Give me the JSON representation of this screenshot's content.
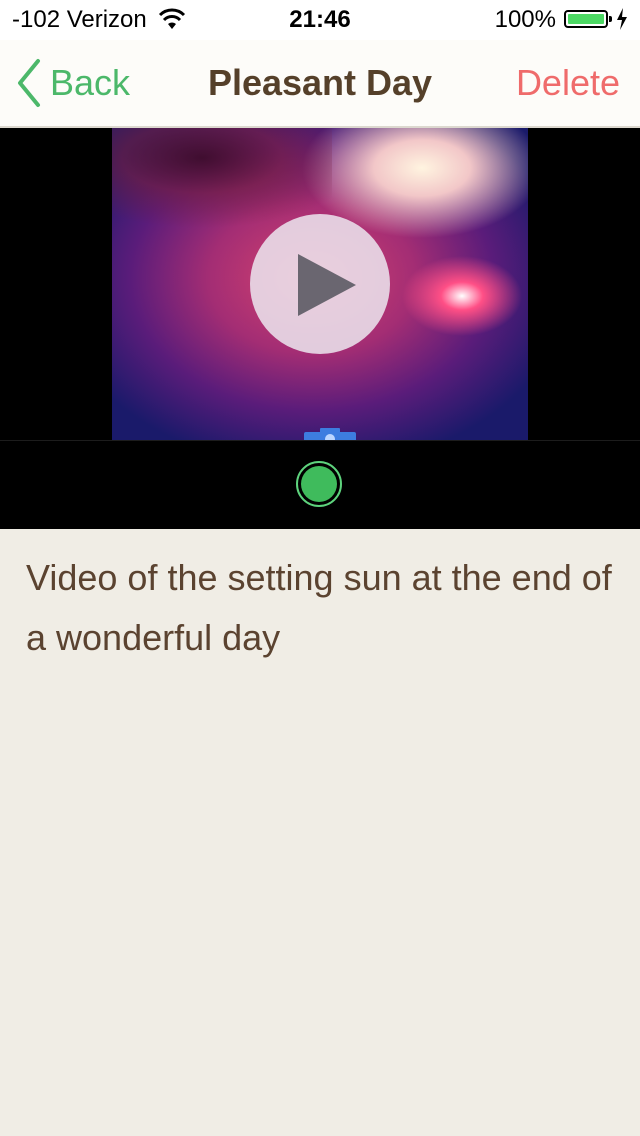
{
  "status_bar": {
    "carrier": "-102 Verizon",
    "time": "21:46",
    "battery_percent": "100%",
    "battery_level": 1.0,
    "battery_color": "#4cd964"
  },
  "nav": {
    "back_label": "Back",
    "title": "Pleasant Day",
    "delete_label": "Delete",
    "back_color": "#4cb86a",
    "delete_color": "#ef6b6b",
    "title_color": "#55402a"
  },
  "video": {
    "play_icon": "play-icon",
    "record_icon": "record-dot-icon"
  },
  "note": {
    "description": "Video of the setting sun at the end of a wonderful day"
  }
}
